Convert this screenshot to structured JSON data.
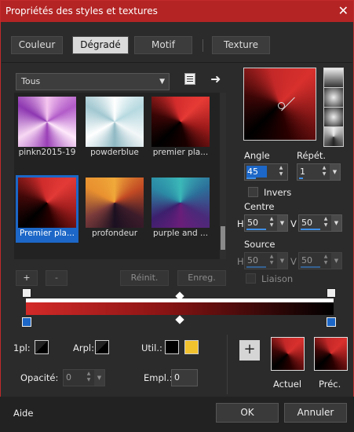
{
  "window": {
    "title": "Propriétés des styles et textures",
    "close_glyph": "✕"
  },
  "tabs": [
    "Couleur",
    "Dégradé",
    "Motif",
    "Texture"
  ],
  "selected_tab": 1,
  "dropdown": {
    "value": "Tous"
  },
  "gallery": [
    {
      "label": "pinkn2015-19"
    },
    {
      "label": "powderblue"
    },
    {
      "label": "premier pla..."
    },
    {
      "label": "Premier pla..."
    },
    {
      "label": "profondeur"
    },
    {
      "label": "purple and ..."
    }
  ],
  "gallery_selected": 3,
  "gallery_buttons": {
    "add": "+",
    "remove": "-",
    "reset": "Réinit.",
    "save": "Enreg."
  },
  "angle": {
    "label": "Angle",
    "value": "45"
  },
  "repeat": {
    "label": "Répét.",
    "value": "1"
  },
  "invert": {
    "label": "Invers"
  },
  "center": {
    "label": "Centre",
    "h_label": "H",
    "h": "50",
    "v_label": "V",
    "v": "50"
  },
  "source": {
    "label": "Source",
    "h_label": "H",
    "h": "50",
    "v_label": "V",
    "v": "50"
  },
  "link": {
    "label": "Liaison"
  },
  "stops": {
    "first_label": "1pl:",
    "arr_label": "Arpl:",
    "util_label": "Util.:",
    "opacity_label": "Opacité:",
    "opacity_value": "0",
    "location_label": "Empl.:",
    "location_value": "0"
  },
  "previews": {
    "current": "Actuel",
    "previous": "Préc.",
    "add": "+"
  },
  "footer": {
    "help": "Aide",
    "ok": "OK",
    "cancel": "Annuler"
  },
  "colors": {
    "accent": "#b42424",
    "selection": "#1c67c7",
    "user_color": "#f2c12e"
  }
}
